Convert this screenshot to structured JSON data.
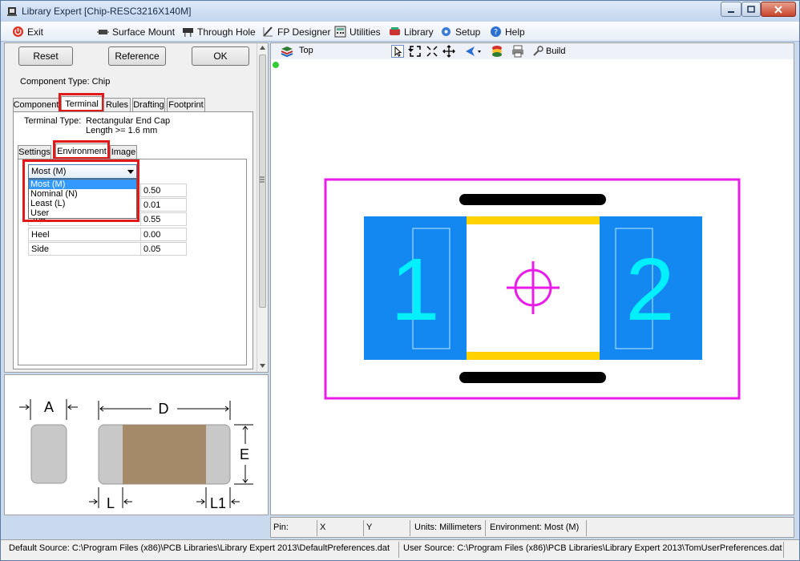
{
  "window": {
    "title": "Library Expert [Chip-RESC3216X140M]"
  },
  "menu": [
    {
      "label": "Exit",
      "icon": "power-icon"
    },
    {
      "label": "Surface Mount",
      "icon": "chip-icon"
    },
    {
      "label": "Through Hole",
      "icon": "through-hole-icon"
    },
    {
      "label": "FP Designer",
      "icon": "designer-icon"
    },
    {
      "label": "Utilities",
      "icon": "calculator-icon"
    },
    {
      "label": "Library",
      "icon": "library-icon"
    },
    {
      "label": "Setup",
      "icon": "setup-gear-icon"
    },
    {
      "label": "Help",
      "icon": "help-icon"
    }
  ],
  "left": {
    "buttons": {
      "reset": "Reset",
      "reference": "Reference",
      "ok": "OK"
    },
    "component_type": "Component Type: Chip",
    "tabs": [
      "Component",
      "Terminal",
      "Rules",
      "Drafting",
      "Footprint"
    ],
    "terminal_type_label": "Terminal Type:",
    "terminal_type_value": "Rectangular End Cap",
    "terminal_type_sub": "Length >= 1.6 mm",
    "subtabs": [
      "Settings",
      "Environment",
      "Image"
    ],
    "combo_value": "Most (M)",
    "dropdown": [
      "Most (M)",
      "Nominal (N)",
      "Least (L)",
      "User"
    ],
    "rows": [
      {
        "k": "",
        "v": "0.50"
      },
      {
        "k": "",
        "v": "0.01"
      },
      {
        "k": "Toe",
        "v": "0.55"
      },
      {
        "k": "Heel",
        "v": "0.00"
      },
      {
        "k": "Side",
        "v": "0.05"
      }
    ]
  },
  "diagram": {
    "labels": {
      "a": "A",
      "d": "D",
      "e": "E",
      "l": "L",
      "l1": "L1"
    }
  },
  "canvas": {
    "layer": "Top",
    "build_label": "Build",
    "pad_labels": [
      "1",
      "2"
    ],
    "colors": {
      "pad": "#1388f0",
      "outline": "#e81ee8",
      "silk": "#000000",
      "body": "#ffd200",
      "text": "#00f0ff"
    }
  },
  "status": {
    "pin": "Pin:",
    "x": "X",
    "y": "Y",
    "units": "Units: Millimeters",
    "env": "Environment: Most (M)"
  },
  "bottom": {
    "default_source": "Default Source:   C:\\Program Files (x86)\\PCB Libraries\\Library Expert 2013\\DefaultPreferences.dat",
    "user_source": "User Source:   C:\\Program Files (x86)\\PCB Libraries\\Library Expert 2013\\TomUserPreferences.dat"
  }
}
